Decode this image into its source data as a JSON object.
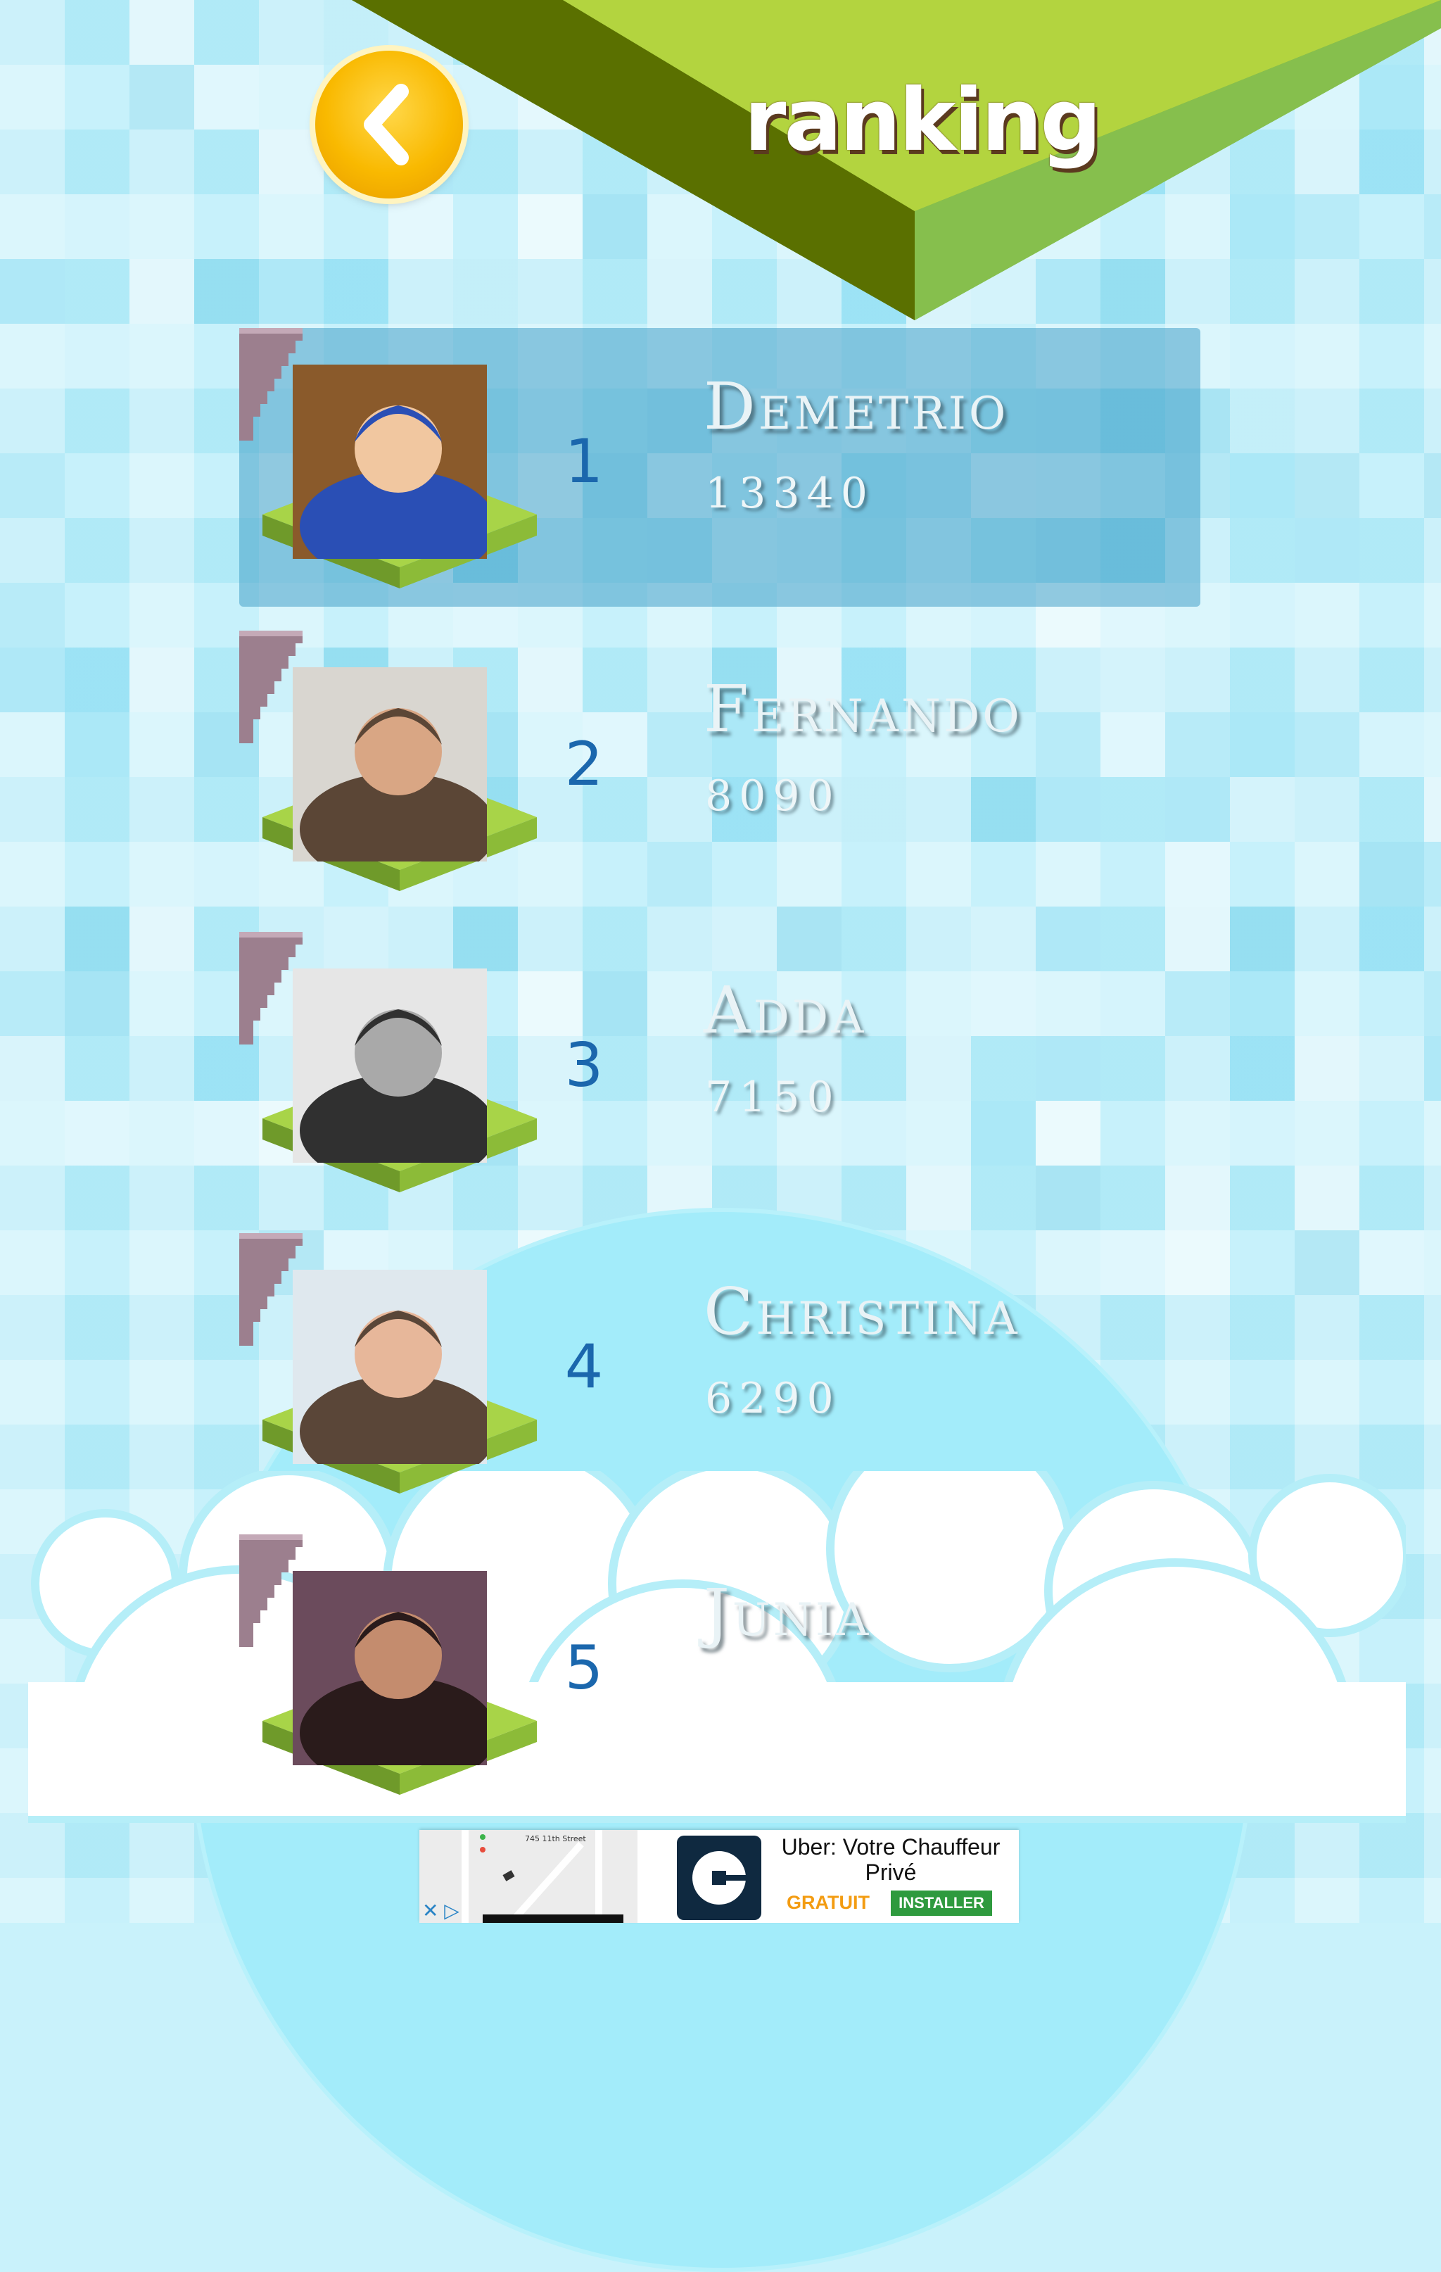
{
  "header": {
    "title": "ranking",
    "back_icon": "chevron-left-icon"
  },
  "ranking": [
    {
      "rank": "1",
      "name": "Demetrio",
      "score": "13340",
      "highlighted": true,
      "avatar_palette": [
        "#8a5a2b",
        "#2a4fb5",
        "#f1c7a0"
      ]
    },
    {
      "rank": "2",
      "name": "Fernando",
      "score": "8090",
      "highlighted": false,
      "avatar_palette": [
        "#d9d6d0",
        "#5b4636",
        "#d9a684"
      ]
    },
    {
      "rank": "3",
      "name": "Adda",
      "score": "7150",
      "highlighted": false,
      "avatar_palette": [
        "#e6e6e6",
        "#303030",
        "#a9a9a9"
      ]
    },
    {
      "rank": "4",
      "name": "Christina",
      "score": "6290",
      "highlighted": false,
      "avatar_palette": [
        "#dfe8ee",
        "#5a4638",
        "#e7b79a"
      ]
    },
    {
      "rank": "5",
      "name": "Junia",
      "score": "",
      "highlighted": false,
      "avatar_palette": [
        "#6b4b5c",
        "#2a1b1b",
        "#c48c6e"
      ]
    }
  ],
  "ad": {
    "map_street": "745 11th Street",
    "title": "Uber: Votre Chauffeur Privé",
    "free_label": "GRATUIT",
    "install_label": "INSTALLER",
    "close_label": "✕ ▷"
  },
  "colors": {
    "banner_dark": "#5a7000",
    "banner_light": "#b3d43f",
    "banner_side": "#7cb542",
    "rank_number": "#1b67ad",
    "highlight_row": "#46a0c8",
    "stairs": "#9c7f8e",
    "platform_top": "#a8d448",
    "platform_side": "#6f9a2a"
  }
}
